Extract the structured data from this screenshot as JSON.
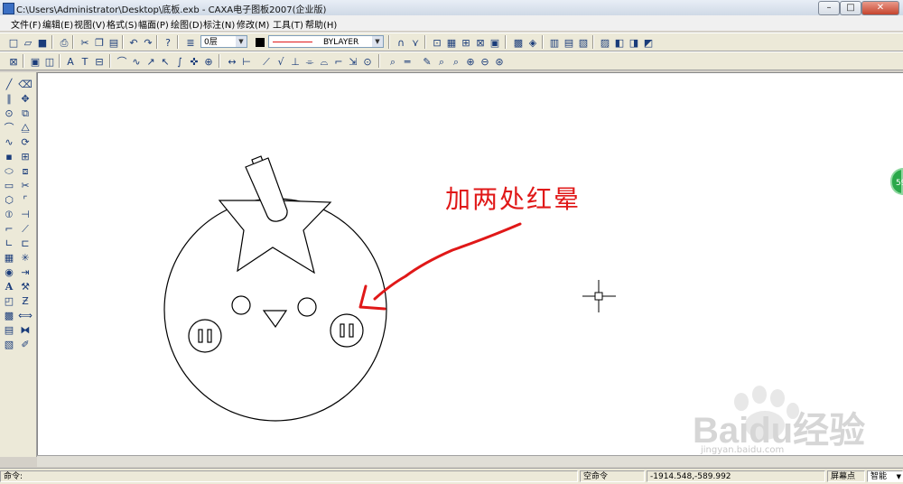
{
  "window": {
    "title": "C:\\Users\\Administrator\\Desktop\\底板.exb - CAXA电子图板2007(企业版)",
    "minimize": "–",
    "maximize": "□",
    "close": "✕"
  },
  "menu": [
    "文件(F)",
    "编辑(E)",
    "视图(V)",
    "格式(S)",
    "幅面(P)",
    "绘图(D)",
    "标注(N)",
    "修改(M)",
    "工具(T)",
    "帮助(H)"
  ],
  "toolbar": {
    "layer_value": "0层",
    "linetype_value": "BYLAYER",
    "color_hex": "#000000",
    "line_color_hex": "#e01818"
  },
  "annotation": {
    "text": "加两处红晕",
    "color": "#e01818"
  },
  "floating_badge": "59",
  "watermark": {
    "brand": "Baidu经验",
    "url": "jingyan.baidu.com"
  },
  "status": {
    "command_label": "命令:",
    "command_state": "空命令",
    "coordinates": "-1914.548,-589.992",
    "snap_mode": "屏幕点",
    "smart_mode": "智能"
  }
}
